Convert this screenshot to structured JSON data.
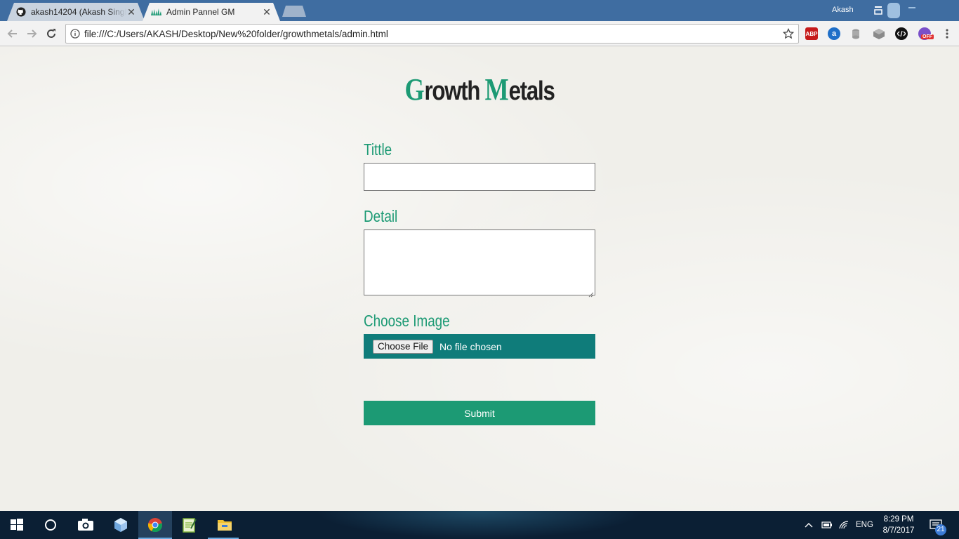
{
  "browser": {
    "tabs": [
      {
        "title": "akash14204 (Akash Singh",
        "icon": "github-icon",
        "active": false
      },
      {
        "title": "Admin Pannel GM",
        "icon": "site-favicon",
        "active": true
      }
    ],
    "profile": "Akash",
    "url": "file:///C:/Users/AKASH/Desktop/New%20folder/growthmetals/admin.html",
    "extensions": [
      "adblock-plus-icon",
      "a-extension-icon",
      "database-icon",
      "cube-icon",
      "code-icon",
      "timer-off-icon"
    ],
    "ext_labels": {
      "abp": "ABP",
      "a": "a",
      "off": "OFF"
    }
  },
  "page": {
    "title_g": "G",
    "title_rowth": "rowth ",
    "title_m": "M",
    "title_etals": "etals",
    "labels": {
      "title": "Tittle",
      "detail": "Detail",
      "image": "Choose Image"
    },
    "file_button": "Choose File",
    "file_status": "No file chosen",
    "submit": "Submit"
  },
  "taskbar": {
    "apps": [
      "start-icon",
      "cortana-icon",
      "camera-icon",
      "cube-3d-icon",
      "chrome-icon",
      "notepad-icon",
      "file-explorer-icon"
    ],
    "lang": "ENG",
    "time": "8:29 PM",
    "date": "8/7/2017",
    "notifications": "21"
  },
  "colors": {
    "accent": "#1c9a74",
    "file_bg": "#0f7c7a",
    "titlebar": "#3f6da1",
    "taskbar": "#0b1f34"
  }
}
